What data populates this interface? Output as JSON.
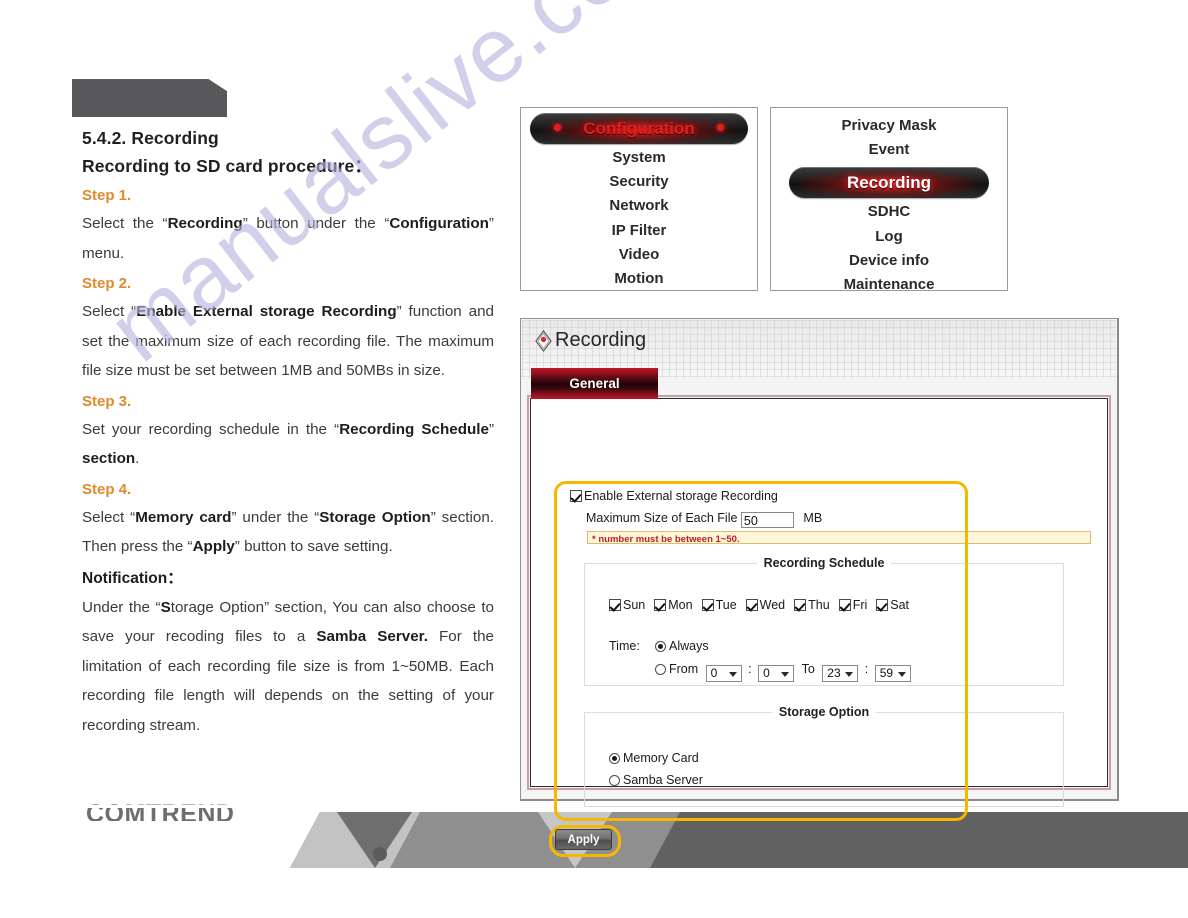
{
  "document": {
    "section_number": "5.4.2.",
    "section_title": "Recording",
    "subtitle": "Recording to SD card procedure：",
    "steps": [
      {
        "label": "Step 1.",
        "text_html": "Select the “<b>Recording</b>” button under the “<b>Configuration</b>” menu."
      },
      {
        "label": "Step 2.",
        "text_html": "Select “<b>Enable External storage Recording</b>” function and set the maximum size of each recording file. The maximum file size must be set between 1MB and 50MBs in size."
      },
      {
        "label": "Step 3.",
        "text_html": "Set your recording schedule in the “<b>Recording Schedule</b>” <b>section</b>."
      },
      {
        "label": "Step 4.",
        "text_html": "Select “<b>Memory card</b>” under the “<b>Storage Option</b>” section. Then press the “<b>Apply</b>” button to save setting."
      }
    ],
    "notification_label": "Notification：",
    "notification_html": "Under the “<b>S</b>torage Option” section, You can also choose to save your recoding files to a <b>Samba Server.</b> For the limitation of each recording file size is from 1~50MB. Each recording file length will depends on the setting of your recording stream.",
    "watermark": "manualslive.com",
    "brand": "COMTREND"
  },
  "menus": {
    "configuration": {
      "header": "Configuration",
      "items": [
        "System",
        "Security",
        "Network",
        "IP Filter",
        "Video",
        "Motion"
      ]
    },
    "submenu": {
      "items_before": [
        "Privacy Mask",
        "Event"
      ],
      "active": "Recording",
      "items_after": [
        "SDHC",
        "Log",
        "Device info",
        "Maintenance"
      ]
    }
  },
  "panel": {
    "title": "Recording",
    "tab_general": "General",
    "enable_checkbox": {
      "label": "Enable External storage Recording",
      "checked": true
    },
    "max_size": {
      "label": "Maximum Size of Each File",
      "value": "50",
      "unit": "MB"
    },
    "warning": "* number must be between 1~50.",
    "recording_schedule": {
      "legend": "Recording Schedule",
      "days": [
        {
          "label": "Sun",
          "checked": true
        },
        {
          "label": "Mon",
          "checked": true
        },
        {
          "label": "Tue",
          "checked": true
        },
        {
          "label": "Wed",
          "checked": true
        },
        {
          "label": "Thu",
          "checked": true
        },
        {
          "label": "Fri",
          "checked": true
        },
        {
          "label": "Sat",
          "checked": true
        }
      ],
      "time_label": "Time:",
      "always_label": "Always",
      "always_selected": true,
      "from_label": "From",
      "to_label": "To",
      "colon": ":",
      "from_hour": "0",
      "from_min": "0",
      "to_hour": "23",
      "to_min": "59"
    },
    "storage_option": {
      "legend": "Storage Option",
      "options": [
        {
          "label": "Memory Card",
          "selected": true
        },
        {
          "label": "Samba Server",
          "selected": false
        }
      ]
    },
    "apply_label": "Apply"
  },
  "colors": {
    "accent_orange": "#e08a2b",
    "highlight_yellow": "#f5b800",
    "menu_red": "#e02020",
    "tab_red": "#c1172a",
    "warn_red": "#c02020",
    "logo_gray": "#6d6d6d"
  }
}
